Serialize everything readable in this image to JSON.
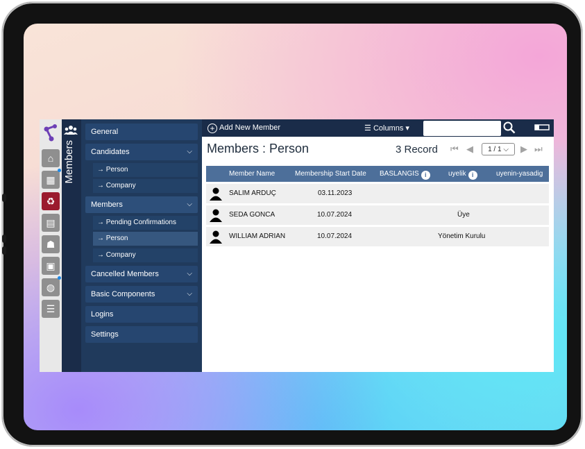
{
  "nav_rail": {
    "icons": [
      "home-icon",
      "building-icon",
      "recycle-icon",
      "calculator-icon",
      "group-icon",
      "id-card-icon",
      "globe-icon",
      "sliders-icon"
    ]
  },
  "vertical_tab": {
    "label": "Members",
    "icon": "members-icon"
  },
  "menu": {
    "general": "General",
    "candidates": "Candidates",
    "candidates_person": "→ Person",
    "candidates_company": "→ Company",
    "members": "Members",
    "members_pending": "→ Pending Confirmations",
    "members_person": "→ Person",
    "members_company": "→ Company",
    "cancelled_members": "Cancelled Members",
    "basic_components": "Basic Components",
    "logins": "Logins",
    "settings": "Settings"
  },
  "toolbar": {
    "add_new_member": "Add New Member",
    "columns": "Columns",
    "search_placeholder": ""
  },
  "page": {
    "title": "Members : Person",
    "record_count": "3 Record",
    "pager_value": "1 / 1"
  },
  "table": {
    "headers": [
      "Member Name",
      "Membership Start Date",
      "BASLANGIS",
      "uyelik",
      "uyenin-yasadig"
    ],
    "rows": [
      {
        "name": "SALIM ARDUÇ",
        "start_date": "03.11.2023",
        "uyelik": ""
      },
      {
        "name": "SEDA GONCA",
        "start_date": "10.07.2024",
        "uyelik": "Üye"
      },
      {
        "name": "WILLIAM ADRIAN",
        "start_date": "10.07.2024",
        "uyelik": "Yönetim Kurulu"
      }
    ]
  },
  "colors": {
    "sidebar_dark": "#1a2c49",
    "menu_bg": "#203a5c",
    "table_header": "#4d6f9a",
    "active_rail": "#9b1b2e"
  }
}
